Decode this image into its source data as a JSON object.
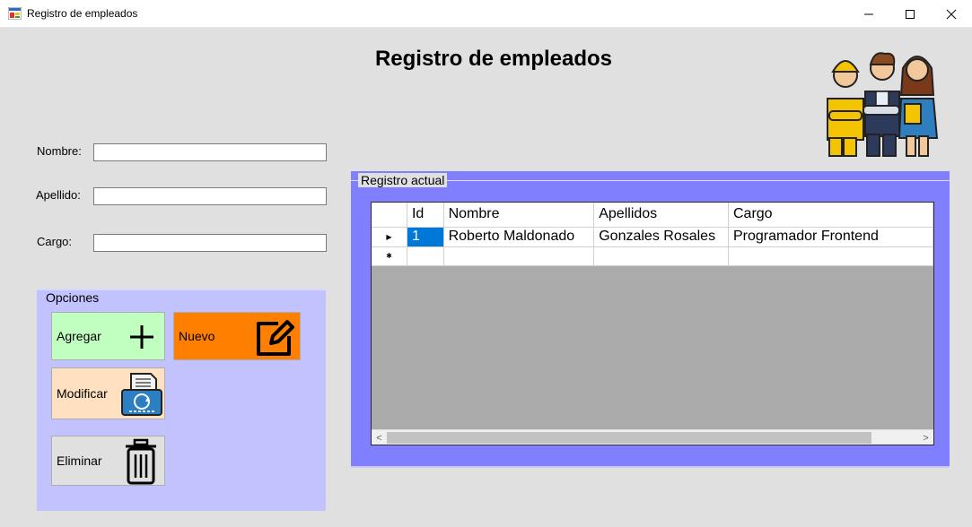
{
  "window": {
    "title": "Registro de empleados",
    "minimize_icon": "minimize-icon",
    "maximize_icon": "maximize-icon",
    "close_icon": "close-icon"
  },
  "header": {
    "title": "Registro de empleados",
    "illustration": "employees-group-icon"
  },
  "form": {
    "nombre_label": "Nombre:",
    "nombre_value": "",
    "apellido_label": "Apellido:",
    "apellido_value": "",
    "cargo_label": "Cargo:",
    "cargo_value": ""
  },
  "opciones": {
    "legend": "Opciones",
    "agregar_label": "Agregar",
    "agregar_icon": "plus-icon",
    "agregar_color": "#c0ffc0",
    "nuevo_label": "Nuevo",
    "nuevo_icon": "edit-icon",
    "nuevo_color": "#ff8000",
    "modificar_label": "Modificar",
    "modificar_icon": "fax-refresh-icon",
    "modificar_color": "#ffe0c0",
    "eliminar_label": "Eliminar",
    "eliminar_icon": "trash-icon",
    "eliminar_color": "#e0e0e0"
  },
  "registro": {
    "legend": "Registro actual",
    "accent_color": "#8080ff",
    "columns": [
      "Id",
      "Nombre",
      "Apellidos",
      "Cargo"
    ],
    "rows": [
      [
        "1",
        "Roberto Maldonado",
        "Gonzales Rosales",
        "Programador Frontend"
      ]
    ],
    "scroll_left": "<",
    "scroll_right": ">"
  }
}
